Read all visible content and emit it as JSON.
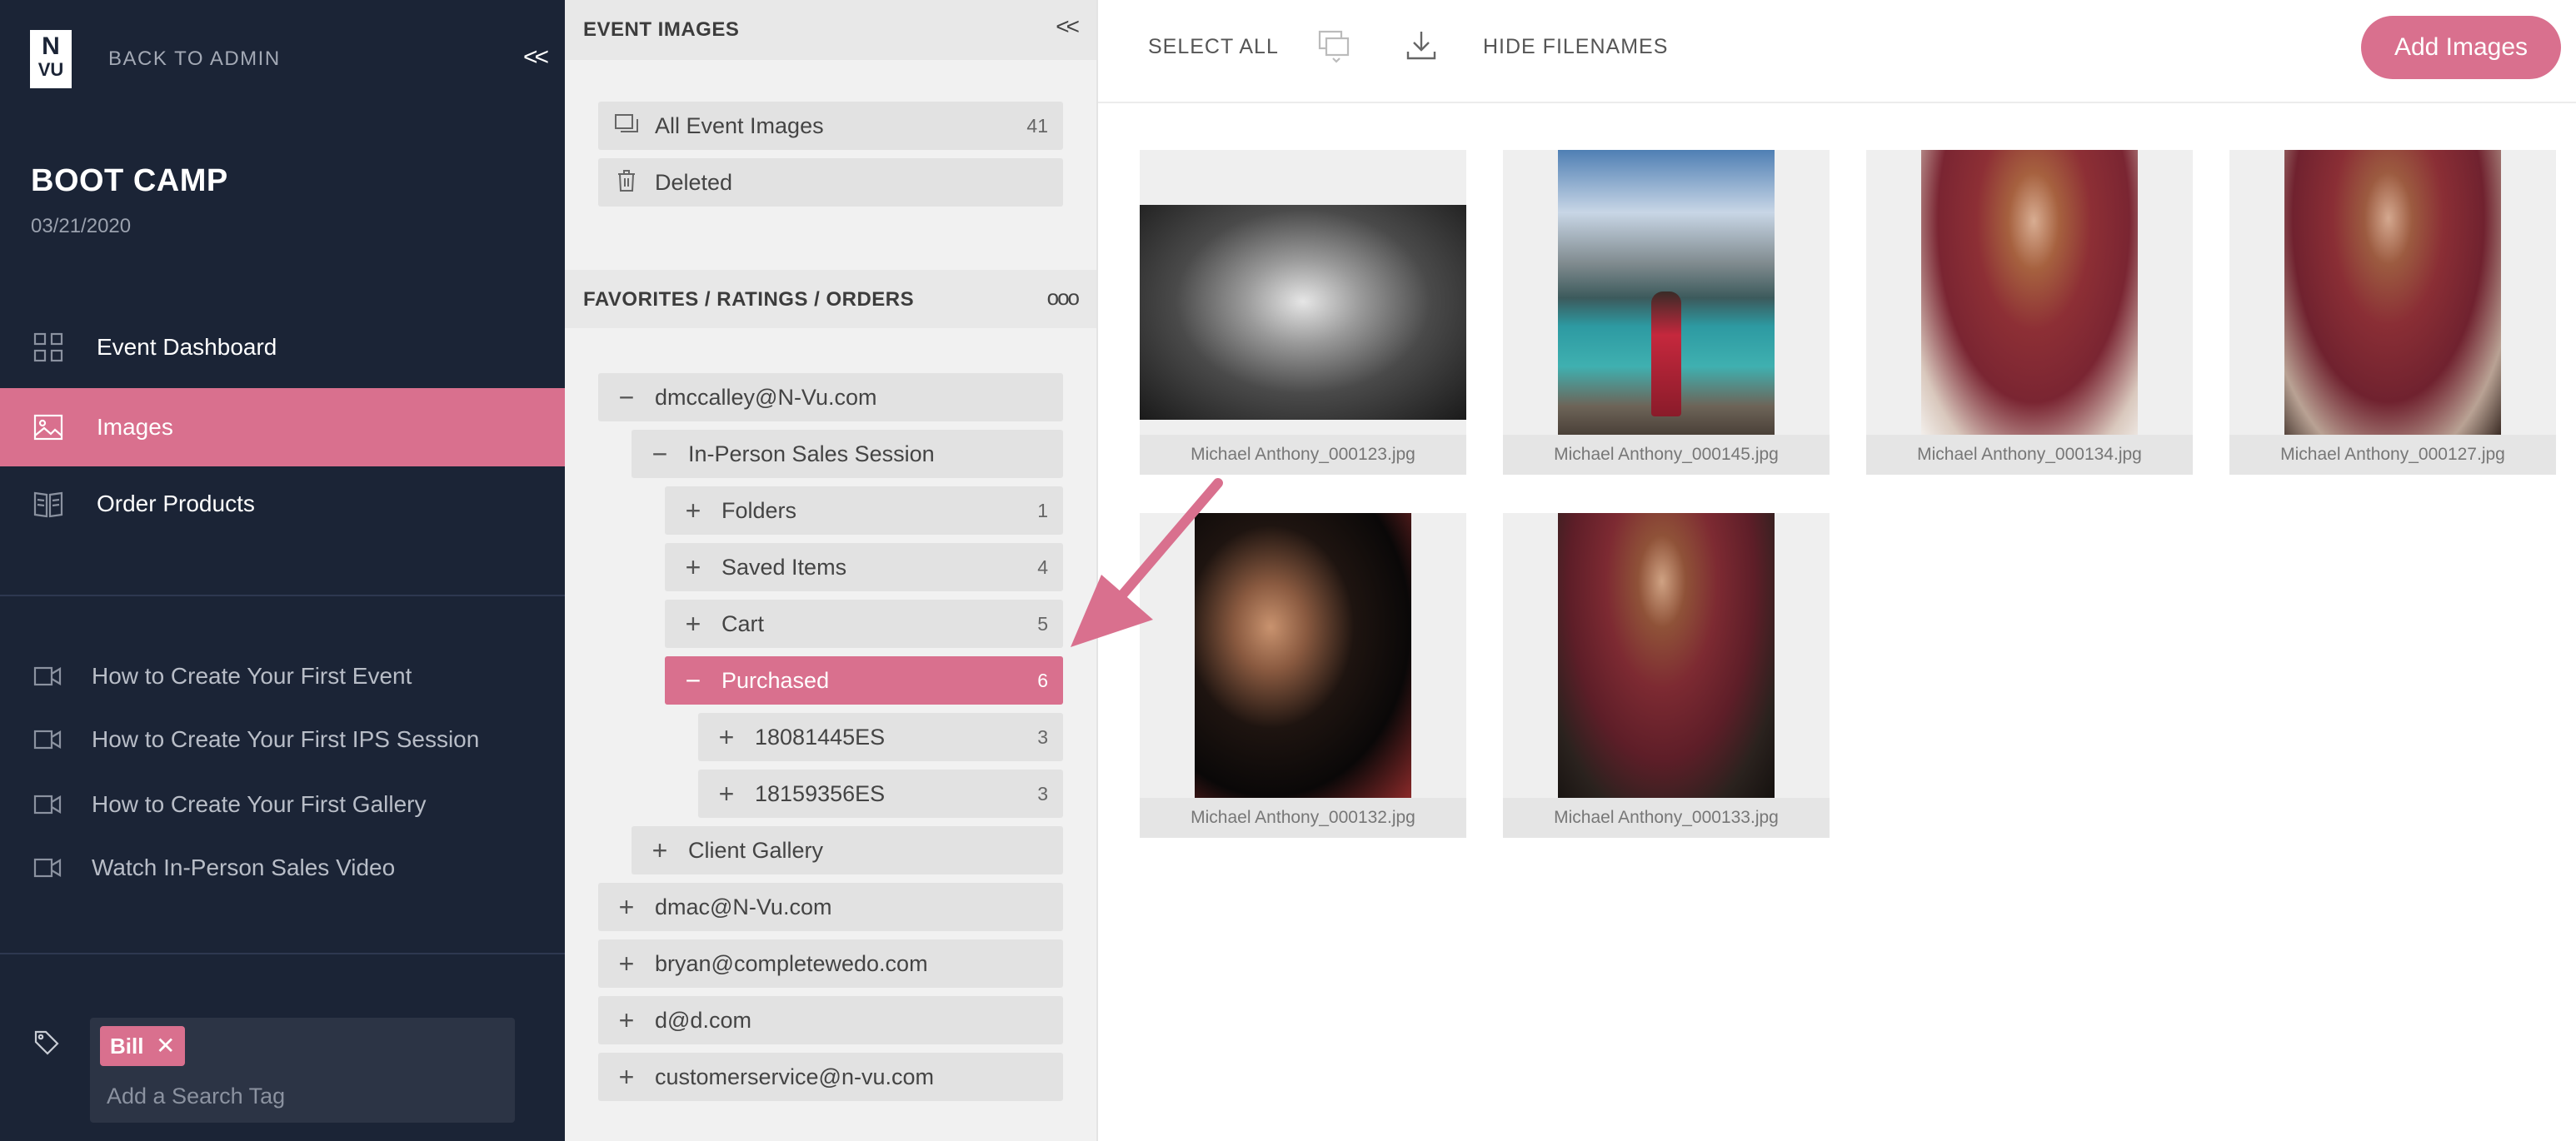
{
  "sidebar": {
    "logo": {
      "top": "N",
      "bottom": "VU"
    },
    "back_label": "BACK TO ADMIN",
    "collapse_label": "<<",
    "event_title": "BOOT CAMP",
    "event_date": "03/21/2020",
    "nav": [
      {
        "label": "Event Dashboard",
        "icon": "grid-icon",
        "active": false
      },
      {
        "label": "Images",
        "icon": "image-icon",
        "active": true
      },
      {
        "label": "Order Products",
        "icon": "book-icon",
        "active": false
      }
    ],
    "help_links": [
      {
        "label": "How to Create Your First Event",
        "icon": "video-icon"
      },
      {
        "label": "How to Create Your First IPS Session",
        "icon": "video-icon"
      },
      {
        "label": "How to Create Your First Gallery",
        "icon": "video-icon"
      },
      {
        "label": "Watch In-Person Sales Video",
        "icon": "video-icon"
      }
    ],
    "tags": [
      {
        "label": "Bill"
      }
    ],
    "tag_remove": "✕",
    "tag_placeholder": "Add a Search Tag"
  },
  "middle": {
    "event_images_header": "EVENT IMAGES",
    "event_images_collapse": "<<",
    "event_image_items": [
      {
        "label": "All Event Images",
        "count": "41",
        "icon": "images-icon"
      },
      {
        "label": "Deleted",
        "count": "",
        "icon": "trash-icon"
      }
    ],
    "favorites_header": "FAVORITES / RATINGS / ORDERS",
    "favorites_more": "ooo",
    "tree": [
      {
        "sign": "−",
        "label": "dmccalley@N-Vu.com",
        "count": ""
      },
      {
        "sign": "−",
        "label": "In-Person Sales Session",
        "count": ""
      },
      {
        "sign": "+",
        "label": "Folders",
        "count": "1"
      },
      {
        "sign": "+",
        "label": "Saved Items",
        "count": "4"
      },
      {
        "sign": "+",
        "label": "Cart",
        "count": "5"
      },
      {
        "sign": "−",
        "label": "Purchased",
        "count": "6"
      },
      {
        "sign": "+",
        "label": "18081445ES",
        "count": "3"
      },
      {
        "sign": "+",
        "label": "18159356ES",
        "count": "3"
      },
      {
        "sign": "+",
        "label": "Client Gallery",
        "count": ""
      },
      {
        "sign": "+",
        "label": "dmac@N-Vu.com",
        "count": ""
      },
      {
        "sign": "+",
        "label": "bryan@completewedo.com",
        "count": ""
      },
      {
        "sign": "+",
        "label": "d@d.com",
        "count": ""
      },
      {
        "sign": "+",
        "label": "customerservice@n-vu.com",
        "count": ""
      }
    ]
  },
  "toolbar": {
    "select_all": "SELECT ALL",
    "hide_filenames": "HIDE FILENAMES",
    "add_images": "Add Images"
  },
  "images": [
    {
      "filename": "Michael Anthony_000123.jpg",
      "style": "bw-landscape"
    },
    {
      "filename": "Michael Anthony_000145.jpg",
      "style": "lake-portrait"
    },
    {
      "filename": "Michael Anthony_000134.jpg",
      "style": "bride-red"
    },
    {
      "filename": "Michael Anthony_000127.jpg",
      "style": "bride-red"
    },
    {
      "filename": "Michael Anthony_000132.jpg",
      "style": "makeup-dark"
    },
    {
      "filename": "Michael Anthony_000133.jpg",
      "style": "bride-red-dark"
    }
  ],
  "colors": {
    "accent": "#d9708e",
    "sidebar_bg": "#1b2436"
  }
}
